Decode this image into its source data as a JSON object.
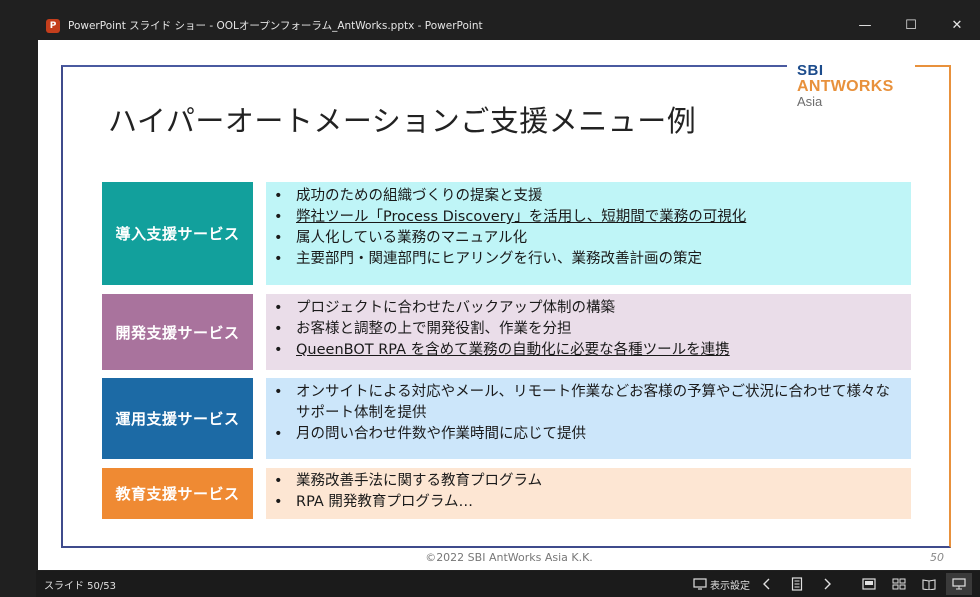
{
  "window": {
    "title": "PowerPoint スライド ショー  -  OOLオープンフォーラム_AntWorks.pptx - PowerPoint",
    "app_icon_letter": "P"
  },
  "controls": {
    "minimize": "—",
    "maximize": "☐",
    "close": "✕"
  },
  "slide": {
    "title": "ハイパーオートメーションご支援メニュー例",
    "logo": {
      "line1": "SBI",
      "line2": "ANTWORKS",
      "line3": "Asia"
    },
    "sections": [
      {
        "label": "導入支援サービス",
        "label_color": "#12a09c",
        "content_bg": "#bff5f7",
        "bullets": [
          "成功のための組織づくりの提案と支援",
          "弊社ツール「Process Discovery」を活用し、短期間で業務の可視化",
          "属人化している業務のマニュアル化",
          "主要部門・関連部門にヒアリングを行い、業務改善計画の策定"
        ]
      },
      {
        "label": "開発支援サービス",
        "label_color": "#a9739d",
        "content_bg": "#eadde9",
        "bullets": [
          "プロジェクトに合わせたバックアップ体制の構築",
          "お客様と調整の上で開発役割、作業を分担",
          "QueenBOT RPA を含めて業務の自動化に必要な各種ツールを連携"
        ]
      },
      {
        "label": "運用支援サービス",
        "label_color": "#1c6aa5",
        "content_bg": "#cce6fa",
        "bullets": [
          "オンサイトによる対応やメール、リモート作業などお客様の予算やご状況に合わせて様々なサポート体制を提供",
          "月の問い合わせ件数や作業時間に応じて提供"
        ]
      },
      {
        "label": "教育支援サービス",
        "label_color": "#ef8a33",
        "content_bg": "#fde6d3",
        "bullets": [
          "業務改善手法に関する教育プログラム",
          "RPA 開発教育プログラム…"
        ]
      }
    ],
    "footer": "©2022 SBI AntWorks Asia K.K.",
    "page_number": "50"
  },
  "statusbar": {
    "slide_counter": "スライド 50/53",
    "display_settings": "表示設定"
  },
  "colors": {
    "frame_blue": "#3f4b8c",
    "frame_orange": "#e8913c"
  }
}
